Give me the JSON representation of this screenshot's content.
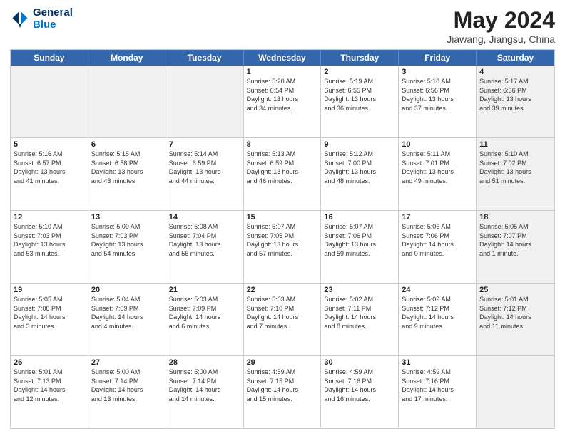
{
  "logo": {
    "line1": "General",
    "line2": "Blue"
  },
  "title": "May 2024",
  "subtitle": "Jiawang, Jiangsu, China",
  "header_days": [
    "Sunday",
    "Monday",
    "Tuesday",
    "Wednesday",
    "Thursday",
    "Friday",
    "Saturday"
  ],
  "rows": [
    [
      {
        "day": "",
        "info": "",
        "shaded": true
      },
      {
        "day": "",
        "info": "",
        "shaded": true
      },
      {
        "day": "",
        "info": "",
        "shaded": true
      },
      {
        "day": "1",
        "info": "Sunrise: 5:20 AM\nSunset: 6:54 PM\nDaylight: 13 hours\nand 34 minutes."
      },
      {
        "day": "2",
        "info": "Sunrise: 5:19 AM\nSunset: 6:55 PM\nDaylight: 13 hours\nand 36 minutes."
      },
      {
        "day": "3",
        "info": "Sunrise: 5:18 AM\nSunset: 6:56 PM\nDaylight: 13 hours\nand 37 minutes."
      },
      {
        "day": "4",
        "info": "Sunrise: 5:17 AM\nSunset: 6:56 PM\nDaylight: 13 hours\nand 39 minutes.",
        "shaded": true
      }
    ],
    [
      {
        "day": "5",
        "info": "Sunrise: 5:16 AM\nSunset: 6:57 PM\nDaylight: 13 hours\nand 41 minutes."
      },
      {
        "day": "6",
        "info": "Sunrise: 5:15 AM\nSunset: 6:58 PM\nDaylight: 13 hours\nand 43 minutes."
      },
      {
        "day": "7",
        "info": "Sunrise: 5:14 AM\nSunset: 6:59 PM\nDaylight: 13 hours\nand 44 minutes."
      },
      {
        "day": "8",
        "info": "Sunrise: 5:13 AM\nSunset: 6:59 PM\nDaylight: 13 hours\nand 46 minutes."
      },
      {
        "day": "9",
        "info": "Sunrise: 5:12 AM\nSunset: 7:00 PM\nDaylight: 13 hours\nand 48 minutes."
      },
      {
        "day": "10",
        "info": "Sunrise: 5:11 AM\nSunset: 7:01 PM\nDaylight: 13 hours\nand 49 minutes."
      },
      {
        "day": "11",
        "info": "Sunrise: 5:10 AM\nSunset: 7:02 PM\nDaylight: 13 hours\nand 51 minutes.",
        "shaded": true
      }
    ],
    [
      {
        "day": "12",
        "info": "Sunrise: 5:10 AM\nSunset: 7:03 PM\nDaylight: 13 hours\nand 53 minutes."
      },
      {
        "day": "13",
        "info": "Sunrise: 5:09 AM\nSunset: 7:03 PM\nDaylight: 13 hours\nand 54 minutes."
      },
      {
        "day": "14",
        "info": "Sunrise: 5:08 AM\nSunset: 7:04 PM\nDaylight: 13 hours\nand 56 minutes."
      },
      {
        "day": "15",
        "info": "Sunrise: 5:07 AM\nSunset: 7:05 PM\nDaylight: 13 hours\nand 57 minutes."
      },
      {
        "day": "16",
        "info": "Sunrise: 5:07 AM\nSunset: 7:06 PM\nDaylight: 13 hours\nand 59 minutes."
      },
      {
        "day": "17",
        "info": "Sunrise: 5:06 AM\nSunset: 7:06 PM\nDaylight: 14 hours\nand 0 minutes."
      },
      {
        "day": "18",
        "info": "Sunrise: 5:05 AM\nSunset: 7:07 PM\nDaylight: 14 hours\nand 1 minute.",
        "shaded": true
      }
    ],
    [
      {
        "day": "19",
        "info": "Sunrise: 5:05 AM\nSunset: 7:08 PM\nDaylight: 14 hours\nand 3 minutes."
      },
      {
        "day": "20",
        "info": "Sunrise: 5:04 AM\nSunset: 7:09 PM\nDaylight: 14 hours\nand 4 minutes."
      },
      {
        "day": "21",
        "info": "Sunrise: 5:03 AM\nSunset: 7:09 PM\nDaylight: 14 hours\nand 6 minutes."
      },
      {
        "day": "22",
        "info": "Sunrise: 5:03 AM\nSunset: 7:10 PM\nDaylight: 14 hours\nand 7 minutes."
      },
      {
        "day": "23",
        "info": "Sunrise: 5:02 AM\nSunset: 7:11 PM\nDaylight: 14 hours\nand 8 minutes."
      },
      {
        "day": "24",
        "info": "Sunrise: 5:02 AM\nSunset: 7:12 PM\nDaylight: 14 hours\nand 9 minutes."
      },
      {
        "day": "25",
        "info": "Sunrise: 5:01 AM\nSunset: 7:12 PM\nDaylight: 14 hours\nand 11 minutes.",
        "shaded": true
      }
    ],
    [
      {
        "day": "26",
        "info": "Sunrise: 5:01 AM\nSunset: 7:13 PM\nDaylight: 14 hours\nand 12 minutes."
      },
      {
        "day": "27",
        "info": "Sunrise: 5:00 AM\nSunset: 7:14 PM\nDaylight: 14 hours\nand 13 minutes."
      },
      {
        "day": "28",
        "info": "Sunrise: 5:00 AM\nSunset: 7:14 PM\nDaylight: 14 hours\nand 14 minutes."
      },
      {
        "day": "29",
        "info": "Sunrise: 4:59 AM\nSunset: 7:15 PM\nDaylight: 14 hours\nand 15 minutes."
      },
      {
        "day": "30",
        "info": "Sunrise: 4:59 AM\nSunset: 7:16 PM\nDaylight: 14 hours\nand 16 minutes."
      },
      {
        "day": "31",
        "info": "Sunrise: 4:59 AM\nSunset: 7:16 PM\nDaylight: 14 hours\nand 17 minutes."
      },
      {
        "day": "",
        "info": "",
        "shaded": true
      }
    ]
  ]
}
